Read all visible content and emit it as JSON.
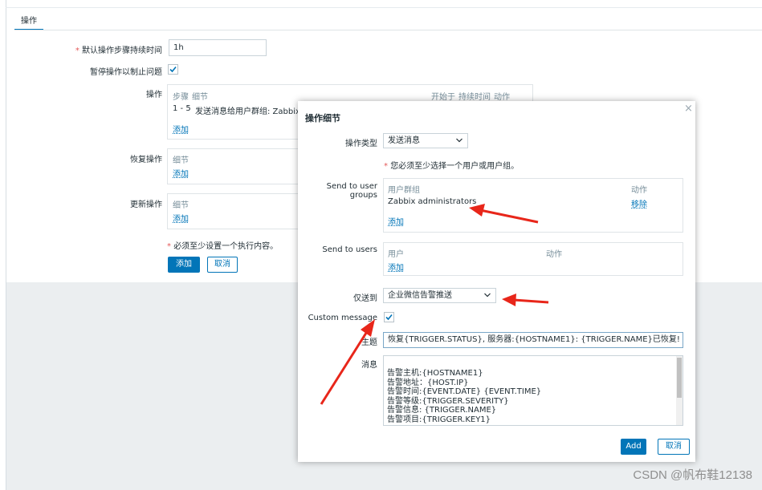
{
  "tab": {
    "label": "操作"
  },
  "form": {
    "default_step_duration": {
      "label": "默认操作步骤持续时间",
      "value": "1h"
    },
    "pause_ops": {
      "label": "暂停操作以制止问题",
      "checked": true
    },
    "operations": {
      "label": "操作",
      "columns": [
        "步骤",
        "细节",
        "开始于",
        "持续时间",
        "动作"
      ],
      "row": {
        "steps": "1 - 5",
        "detail": "发送消息给用户群组: Zabbix a"
      },
      "add": "添加"
    },
    "recovery": {
      "label": "恢复操作",
      "column": "细节",
      "add": "添加"
    },
    "update": {
      "label": "更新操作",
      "column": "细节",
      "add": "添加"
    },
    "note": "必须至少设置一个执行内容。",
    "buttons": {
      "add": "添加",
      "cancel": "取消"
    }
  },
  "dialog": {
    "title": "操作细节",
    "close": "×",
    "op_type": {
      "label": "操作类型",
      "value": "发送消息"
    },
    "hint": "您必须至少选择一个用户或用户组。",
    "user_groups": {
      "label": "Send to user groups",
      "col1": "用户群组",
      "col2": "动作",
      "row_name": "Zabbix administrators",
      "row_action": "移除",
      "add": "添加"
    },
    "users": {
      "label": "Send to users",
      "col1": "用户",
      "col2": "动作",
      "add": "添加"
    },
    "send_only_to": {
      "label": "仅送到",
      "value": "企业微信告警推送"
    },
    "custom_message": {
      "label": "Custom message",
      "checked": true
    },
    "subject": {
      "label": "主题",
      "value": "恢复{TRIGGER.STATUS}, 服务器:{HOSTNAME1}: {TRIGGER.NAME}已恢复!"
    },
    "message": {
      "label": "消息",
      "lines": [
        "告警主机:{HOSTNAME1}",
        "告警地址：{HOST.IP}",
        "告警时间:{EVENT.DATE} {EVENT.TIME}",
        "告警等级:{TRIGGER.SEVERITY}",
        "告警信息: {TRIGGER.NAME}",
        "告警项目:{TRIGGER.KEY1}"
      ]
    },
    "buttons": {
      "add": "Add",
      "cancel": "取消"
    }
  },
  "watermark": "CSDN @帆布鞋12138",
  "colors": {
    "accent": "#0275b8",
    "required": "#e45959",
    "annotation_arrow": "#e8261a"
  }
}
